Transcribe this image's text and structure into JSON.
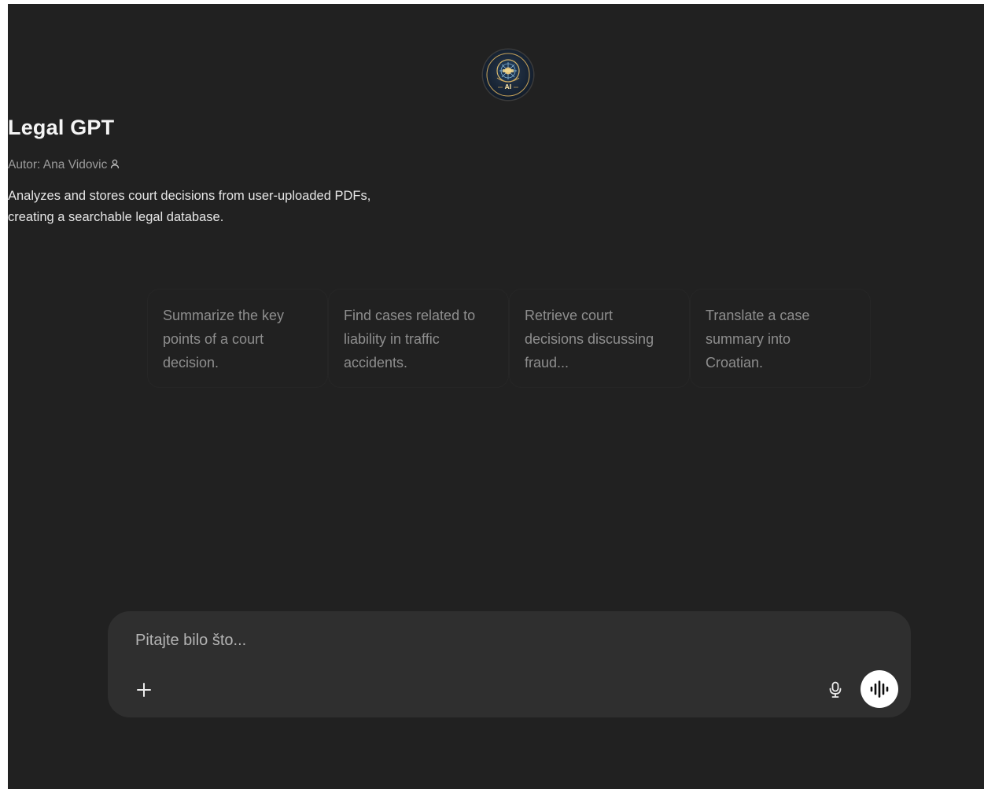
{
  "gpt": {
    "logo_text": "AI",
    "title": "Legal GPT",
    "author": "Autor: Ana Vidovic",
    "description_line1": "Analyzes and stores court decisions from user-uploaded PDFs,",
    "description_line2": "creating a searchable legal database."
  },
  "conversation_starters": [
    {
      "label": "Summarize the key points of a court decision."
    },
    {
      "label": "Find cases related to liability in traffic accidents."
    },
    {
      "label": "Retrieve court decisions discussing fraud..."
    },
    {
      "label": "Translate a case summary into Croatian."
    }
  ],
  "composer": {
    "placeholder": "Pitajte bilo što...",
    "value": ""
  },
  "icons": {
    "author": "person-icon",
    "attach": "plus-icon",
    "dictate": "microphone-icon",
    "voice": "voice-waveform-icon"
  },
  "colors": {
    "background": "#212121",
    "composer": "#2f2f2f",
    "text_primary": "#ececec",
    "text_muted": "#9b9b9b",
    "voice_button": "#ffffff"
  }
}
